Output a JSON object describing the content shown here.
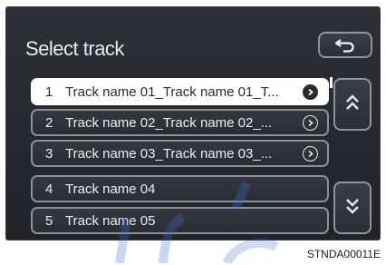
{
  "screen": {
    "title": "Select track",
    "back_icon": "back-arrow-icon"
  },
  "tracks": [
    {
      "number": "1",
      "label": "Track name 01_Track name 01_T...",
      "selected": true,
      "has_detail": true
    },
    {
      "number": "2",
      "label": "Track name 02_Track name 02_...",
      "selected": false,
      "has_detail": true
    },
    {
      "number": "3",
      "label": "Track name 03_Track name 03_...",
      "selected": false,
      "has_detail": true
    },
    {
      "number": "4",
      "label": "Track name 04",
      "selected": false,
      "has_detail": false
    },
    {
      "number": "5",
      "label": "Track name 05",
      "selected": false,
      "has_detail": false
    }
  ],
  "scroll": {
    "up_icon": "double-chevron-up-icon",
    "down_icon": "double-chevron-down-icon"
  },
  "caption": {
    "code": "STNDA00011E"
  },
  "colors": {
    "screen_bg": "#2a2d33",
    "row_border": "#8c9098",
    "selected_bg": "#ffffff",
    "watermark": "#3d6fd6"
  }
}
